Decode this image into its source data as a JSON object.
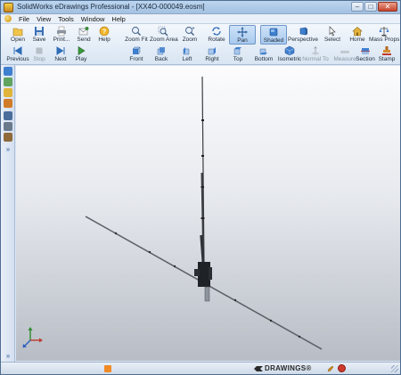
{
  "window": {
    "title": "SolidWorks eDrawings Professional - [XX4O-000049.eosm]",
    "controls": {
      "minimize": "–",
      "maximize": "□",
      "close": "✕"
    }
  },
  "menu": [
    "File",
    "View",
    "Tools",
    "Window",
    "Help"
  ],
  "toolbar_row1": [
    {
      "label": "Open",
      "icon": "folder-open-icon"
    },
    {
      "label": "Save",
      "icon": "save-disk-icon"
    },
    {
      "label": "Print...",
      "icon": "printer-icon"
    },
    {
      "label": "Send",
      "icon": "send-mail-icon"
    },
    {
      "label": "Help",
      "icon": "help-icon"
    },
    {
      "label": "Zoom Fit",
      "icon": "zoom-fit-icon"
    },
    {
      "label": "Zoom Area",
      "icon": "zoom-area-icon"
    },
    {
      "label": "Zoom",
      "icon": "zoom-icon"
    },
    {
      "label": "Rotate",
      "icon": "rotate-icon"
    },
    {
      "label": "Pan",
      "icon": "pan-icon",
      "active": true
    },
    {
      "label": "Shaded",
      "icon": "shaded-icon",
      "active": true
    },
    {
      "label": "Perspective",
      "icon": "perspective-icon"
    },
    {
      "label": "Select",
      "icon": "select-arrow-icon"
    },
    {
      "label": "Home",
      "icon": "home-icon"
    },
    {
      "label": "Mass Props",
      "icon": "mass-props-icon"
    }
  ],
  "toolbar_row2": [
    {
      "label": "Previous",
      "icon": "previous-icon"
    },
    {
      "label": "Stop",
      "icon": "stop-icon",
      "disabled": true
    },
    {
      "label": "Next",
      "icon": "next-icon"
    },
    {
      "label": "Play",
      "icon": "play-icon"
    },
    {
      "label": "Front",
      "icon": "front-view-icon"
    },
    {
      "label": "Back",
      "icon": "back-view-icon"
    },
    {
      "label": "Left",
      "icon": "left-view-icon"
    },
    {
      "label": "Right",
      "icon": "right-view-icon"
    },
    {
      "label": "Top",
      "icon": "top-view-icon"
    },
    {
      "label": "Bottom",
      "icon": "bottom-view-icon"
    },
    {
      "label": "Isometric",
      "icon": "isometric-view-icon"
    },
    {
      "label": "Normal To",
      "icon": "normal-to-icon",
      "disabled": true
    },
    {
      "label": "Measure",
      "icon": "measure-icon",
      "disabled": true
    },
    {
      "label": "Section",
      "icon": "section-icon"
    },
    {
      "label": "Stamp",
      "icon": "stamp-icon"
    }
  ],
  "left_tools": [
    "components-icon",
    "configurations-icon",
    "markup-icon",
    "pencil-icon",
    "sheets-icon",
    "layers-icon",
    "measure-side-icon",
    "expand-icon"
  ],
  "status": {
    "brand": "DRAWINGS®"
  },
  "colors": {
    "accent": "#4f6e93",
    "active_button": "#a8c9ee",
    "viewport_top": "#fcfcfd",
    "viewport_bottom": "#b8bdc5"
  }
}
